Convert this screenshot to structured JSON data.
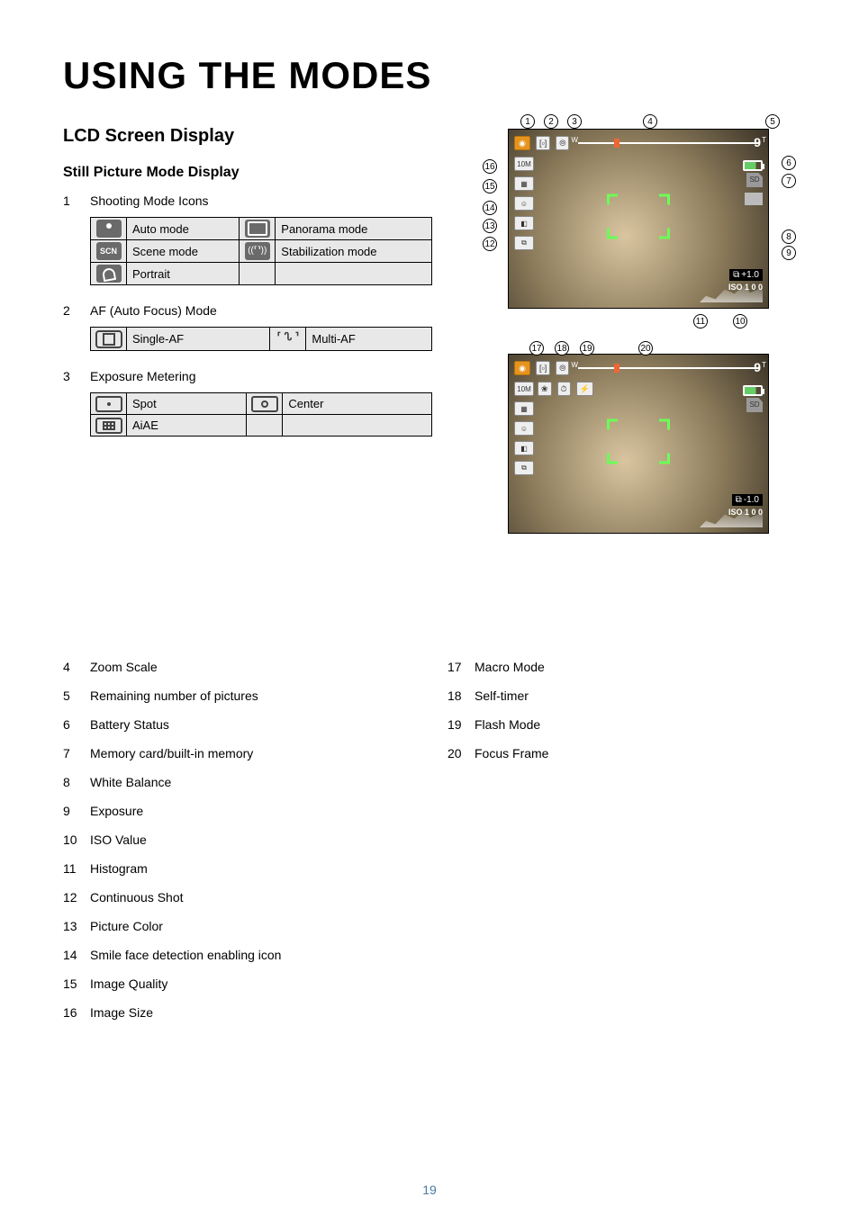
{
  "page_title": "USING THE MODES",
  "h2": "LCD Screen Display",
  "h3": "Still Picture Mode Display",
  "intro_item": {
    "num": "1",
    "text": "Shooting Mode Icons"
  },
  "shoot_table": {
    "r1c1": "Auto mode",
    "r1c2": "Panorama mode",
    "r2c1": "Scene mode",
    "r2c2": "Stabilization mode",
    "r3c1": "Portrait"
  },
  "af_item": {
    "num": "2",
    "text": "AF (Auto Focus) Mode"
  },
  "af_table": {
    "c1": "Single-AF",
    "c2": "Multi-AF"
  },
  "meter_item": {
    "num": "3",
    "text": "Exposure Metering"
  },
  "meter_table": {
    "r1c1": "Spot",
    "r1c2": "Center",
    "r2c1": "AiAE"
  },
  "scn_label": "SCN",
  "stab_label": "((⸢⸣))",
  "multi_af_label": "⸢ ᔐ ⸣",
  "lcd": {
    "count": "9",
    "ev1": "+1.0",
    "ev2": "-1.0",
    "iso": "ISO 1 0 0",
    "size": "10M",
    "w": "W",
    "t": "T",
    "card": "SD"
  },
  "left_list": [
    {
      "num": "4",
      "text": "Zoom Scale"
    },
    {
      "num": "5",
      "text": "Remaining number of pictures"
    },
    {
      "num": "6",
      "text": "Battery Status"
    },
    {
      "num": "7",
      "text": "Memory card/built-in memory"
    },
    {
      "num": "8",
      "text": "White Balance"
    },
    {
      "num": "9",
      "text": "Exposure"
    },
    {
      "num": "10",
      "text": "ISO Value"
    },
    {
      "num": "11",
      "text": "Histogram"
    },
    {
      "num": "12",
      "text": "Continuous Shot"
    },
    {
      "num": "13",
      "text": "Picture Color"
    },
    {
      "num": "14",
      "text": "Smile face detection enabling icon"
    },
    {
      "num": "15",
      "text": "Image Quality"
    },
    {
      "num": "16",
      "text": "Image Size"
    }
  ],
  "right_list": [
    {
      "num": "17",
      "text": "Macro Mode"
    },
    {
      "num": "18",
      "text": "Self-timer"
    },
    {
      "num": "19",
      "text": "Flash Mode"
    },
    {
      "num": "20",
      "text": "Focus Frame"
    }
  ],
  "callouts_top": [
    "1",
    "2",
    "3",
    "4",
    "5",
    "6",
    "7",
    "8",
    "9",
    "10",
    "11",
    "12",
    "13",
    "14",
    "15",
    "16"
  ],
  "callouts_bottom": [
    "17",
    "18",
    "19",
    "20"
  ],
  "page_number": "19"
}
